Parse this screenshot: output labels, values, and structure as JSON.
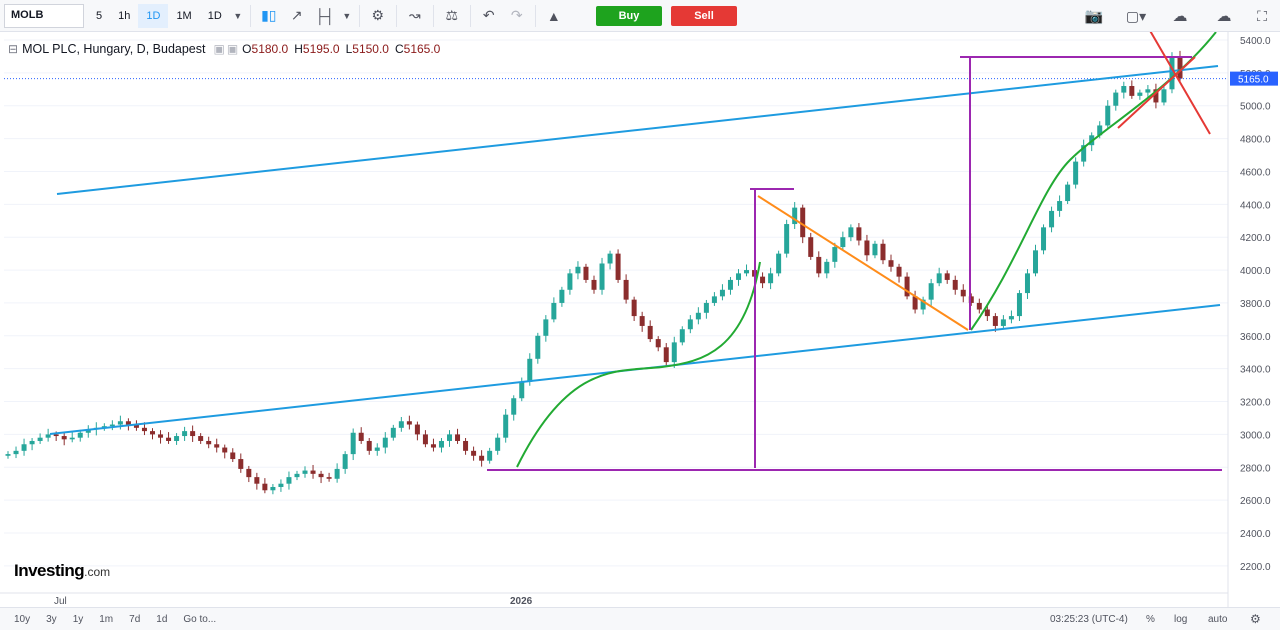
{
  "toolbar": {
    "symbol": "MOLB",
    "intervals": [
      "5",
      "1h",
      "1D",
      "1M",
      "1D"
    ],
    "active_interval_index": 2,
    "buy_label": "Buy",
    "sell_label": "Sell"
  },
  "legend": {
    "title": "MOL PLC, Hungary, D, Budapest",
    "open_label": "O",
    "open": "5180.0",
    "high_label": "H",
    "high": "5195.0",
    "low_label": "L",
    "low": "5150.0",
    "close_label": "C",
    "close": "5165.0"
  },
  "price_axis": {
    "ticks": [
      "5400.0",
      "5200.0",
      "5000.0",
      "4800.0",
      "4600.0",
      "4400.0",
      "4200.0",
      "4000.0",
      "3800.0",
      "3600.0",
      "3400.0",
      "3200.0",
      "3000.0",
      "2800.0",
      "2600.0",
      "2400.0",
      "2200.0"
    ],
    "current_price": "5165.0"
  },
  "time_axis": {
    "labels": [
      "Jul",
      "2026"
    ]
  },
  "bottom": {
    "ranges": [
      "10y",
      "3y",
      "1y",
      "1m",
      "7d",
      "1d",
      "Go to..."
    ],
    "clock": "03:25:23 (UTC-4)",
    "percent_label": "%",
    "log_label": "log",
    "auto_label": "auto"
  },
  "logo": {
    "main": "Investing",
    "suffix": ".com"
  },
  "colors": {
    "up": "#26a69a",
    "down": "#8b2d2d",
    "channel": "#1e9be0",
    "curve": "#22aa33",
    "trend": "#ff8c1a",
    "measure": "#9c27b0",
    "cross": "#e53935",
    "price_tag": "#2962ff"
  },
  "chart_data": {
    "type": "candlestick",
    "title": "MOL PLC, Hungary, D, Budapest",
    "ylim": [
      2060,
      5520
    ],
    "x_labels": [
      "Jul",
      "2026"
    ],
    "last": {
      "open": 5180.0,
      "high": 5195.0,
      "low": 5150.0,
      "close": 5165.0
    },
    "closes": [
      2880,
      2900,
      2940,
      2960,
      2980,
      3000,
      2990,
      2970,
      2980,
      3010,
      3030,
      3040,
      3050,
      3060,
      3080,
      3060,
      3040,
      3020,
      3000,
      2980,
      2960,
      2990,
      3020,
      2990,
      2960,
      2940,
      2920,
      2890,
      2850,
      2790,
      2740,
      2700,
      2660,
      2680,
      2700,
      2740,
      2760,
      2780,
      2760,
      2740,
      2730,
      2790,
      2880,
      3010,
      2960,
      2900,
      2920,
      2980,
      3040,
      3080,
      3060,
      3000,
      2940,
      2920,
      2960,
      3000,
      2960,
      2900,
      2870,
      2840,
      2900,
      2980,
      3120,
      3220,
      3320,
      3460,
      3600,
      3700,
      3800,
      3880,
      3980,
      4020,
      3940,
      3880,
      4040,
      4100,
      3940,
      3820,
      3720,
      3660,
      3580,
      3530,
      3440,
      3560,
      3640,
      3700,
      3740,
      3800,
      3840,
      3880,
      3940,
      3980,
      4000,
      3960,
      3920,
      3980,
      4100,
      4280,
      4380,
      4200,
      4080,
      3980,
      4050,
      4140,
      4200,
      4260,
      4180,
      4090,
      4160,
      4060,
      4020,
      3960,
      3840,
      3760,
      3820,
      3920,
      3980,
      3940,
      3880,
      3840,
      3800,
      3760,
      3720,
      3660,
      3700,
      3720,
      3860,
      3980,
      4120,
      4260,
      4360,
      4420,
      4520,
      4660,
      4760,
      4820,
      4880,
      5000,
      5080,
      5120,
      5060,
      5080,
      5100,
      5020,
      5100,
      5300,
      5165
    ]
  },
  "drawings": {
    "channel_upper": {
      "start": [
        "Jun",
        4460
      ],
      "end": [
        "Jun-end",
        5220
      ]
    },
    "channel_lower": {
      "start": [
        "Jul",
        3010
      ],
      "end": [
        "2026-end",
        3800
      ]
    }
  }
}
